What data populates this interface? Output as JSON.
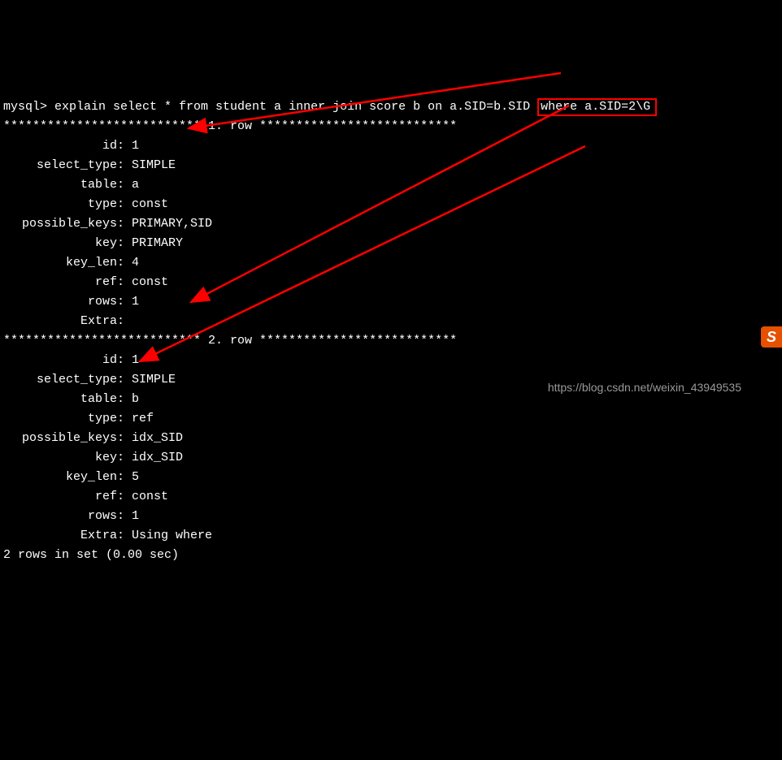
{
  "prompt": {
    "prefix": "mysql> ",
    "cmd_main": "explain select * from student a inner join score b on a.SID=b.SID ",
    "cmd_boxed": "where a.SID=2\\G"
  },
  "row1_header": "*************************** 1. row ***************************",
  "row1": {
    "id": "1",
    "select_type": "SIMPLE",
    "table": "a",
    "type": "const",
    "possible_keys": "PRIMARY,SID",
    "key": "PRIMARY",
    "key_len": "4",
    "ref": "const",
    "rows": "1",
    "Extra": ""
  },
  "row2_header": "*************************** 2. row ***************************",
  "row2": {
    "id": "1",
    "select_type": "SIMPLE",
    "table": "b",
    "type": "ref",
    "possible_keys": "idx_SID",
    "key": "idx_SID",
    "key_len": "5",
    "ref": "const",
    "rows": "1",
    "Extra": "Using where"
  },
  "footer": "2 rows in set (0.00 sec)",
  "labels": {
    "id": "id",
    "select_type": "select_type",
    "table": "table",
    "type": "type",
    "possible_keys": "possible_keys",
    "key": "key",
    "key_len": "key_len",
    "ref": "ref",
    "rows": "rows",
    "Extra": "Extra"
  },
  "watermark": "https://blog.csdn.net/weixin_43949535",
  "badge": "S"
}
